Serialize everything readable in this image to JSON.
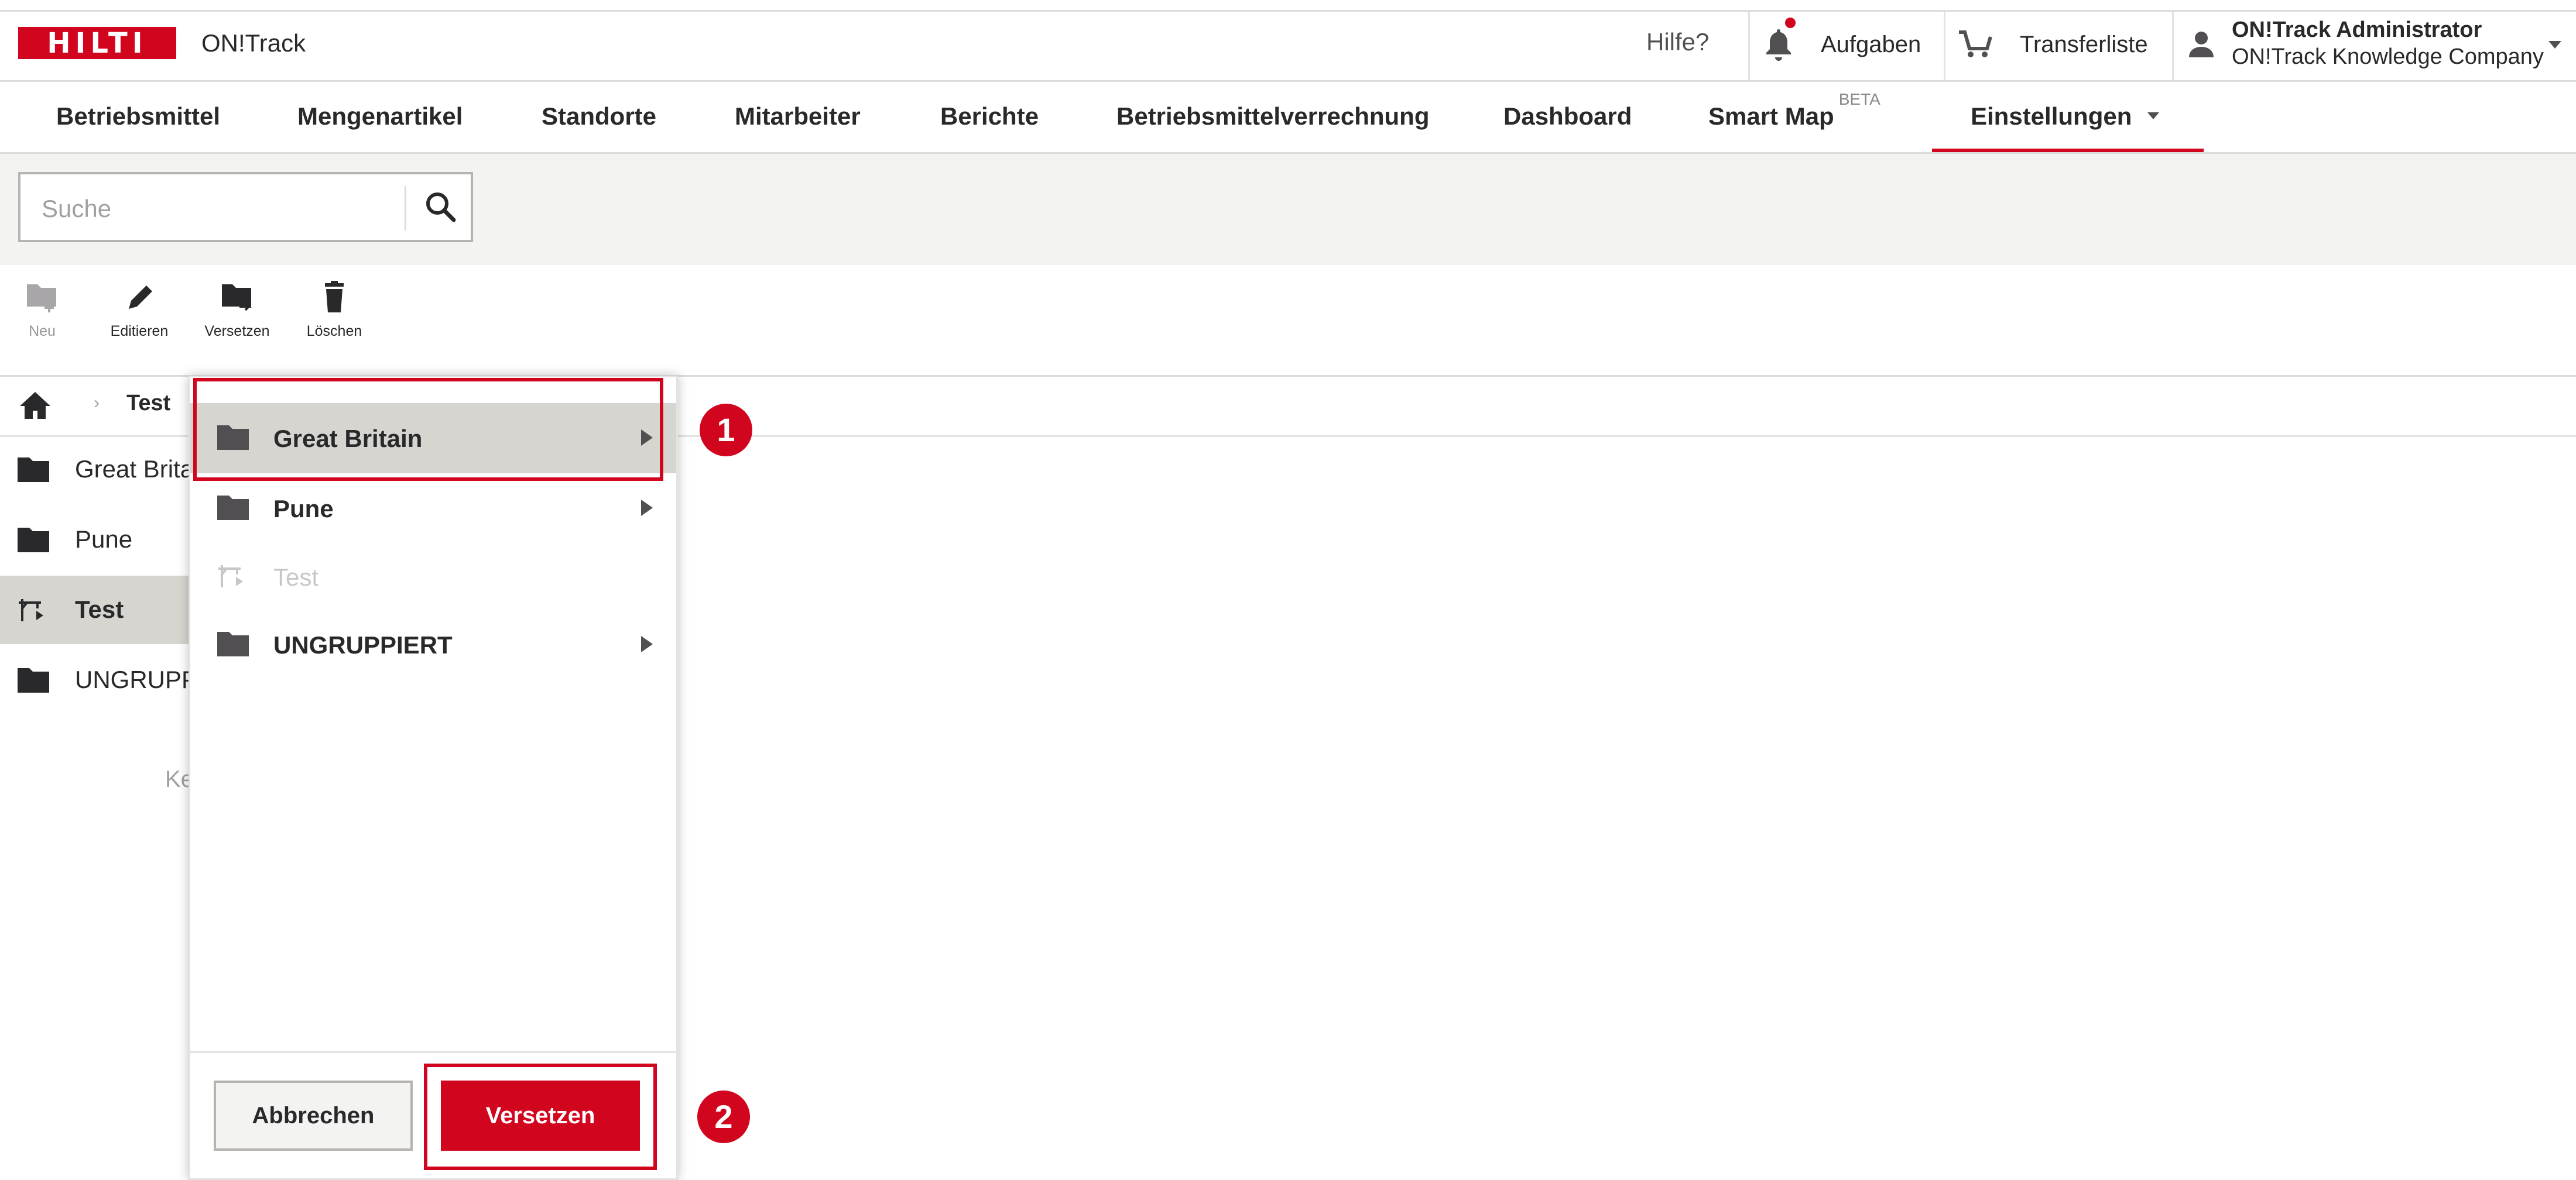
{
  "brand": {
    "logo_text": "HILTI",
    "app_name": "ON!Track",
    "accent_color": "#d2051e"
  },
  "header": {
    "help_label": "Hilfe?",
    "tasks_label": "Aufgaben",
    "transfer_label": "Transferliste",
    "user_name": "ON!Track Administrator",
    "company_name": "ON!Track Knowledge Company",
    "icons": [
      "bell-icon",
      "cart-icon",
      "user-icon",
      "chevron-down-icon"
    ]
  },
  "nav": {
    "items": [
      {
        "label": "Betriebsmittel"
      },
      {
        "label": "Mengenartikel"
      },
      {
        "label": "Standorte"
      },
      {
        "label": "Mitarbeiter"
      },
      {
        "label": "Berichte"
      },
      {
        "label": "Betriebsmittelverrechnung"
      },
      {
        "label": "Dashboard"
      },
      {
        "label": "Smart Map",
        "badge": "BETA"
      },
      {
        "label": "Einstellungen",
        "active": true
      }
    ]
  },
  "search": {
    "placeholder": "Suche",
    "value": ""
  },
  "toolbar": {
    "new_label": "Neu",
    "edit_label": "Editieren",
    "move_label": "Versetzen",
    "delete_label": "Löschen"
  },
  "breadcrumb": {
    "current": "Test"
  },
  "list": {
    "items": [
      {
        "label": "Great Brita",
        "icon": "folder-icon"
      },
      {
        "label": "Pune",
        "icon": "folder-icon"
      },
      {
        "label": "Test",
        "icon": "construction-site-icon",
        "selected": true
      },
      {
        "label": "UNGRUPPI",
        "icon": "folder-icon"
      }
    ],
    "hint_fragment": "Ke"
  },
  "move_dialog": {
    "items": [
      {
        "label": "Great Britain",
        "icon": "folder-icon",
        "has_children": true,
        "highlighted": true
      },
      {
        "label": "Pune",
        "icon": "folder-icon",
        "has_children": true
      },
      {
        "label": "Test",
        "icon": "construction-site-icon",
        "disabled": true
      },
      {
        "label": "UNGRUPPIERT",
        "icon": "folder-icon",
        "has_children": true
      }
    ],
    "cancel_label": "Abbrechen",
    "confirm_label": "Versetzen"
  },
  "callouts": {
    "step1": "1",
    "step2": "2"
  }
}
